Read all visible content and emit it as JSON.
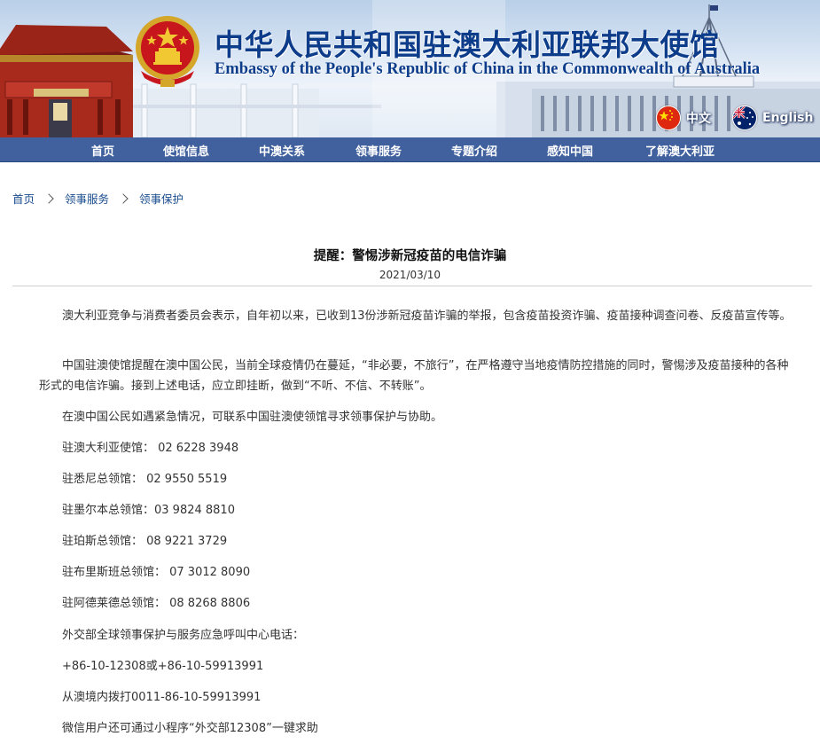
{
  "header": {
    "title_cn": "中华人民共和国驻澳大利亚联邦大使馆",
    "title_en": "Embassy of the People's Republic of China in the Commonwealth of Australia",
    "lang_cn": "中文",
    "lang_en": "English"
  },
  "nav": {
    "items": [
      "首页",
      "使馆信息",
      "中澳关系",
      "领事服务",
      "专题介绍",
      "感知中国",
      "了解澳大利亚"
    ]
  },
  "breadcrumb": [
    "首页",
    "领事服务",
    "领事保护"
  ],
  "article": {
    "title": "提醒：警惕涉新冠疫苗的电信诈骗",
    "date": "2021/03/10",
    "paragraphs": [
      "澳大利亚竞争与消费者委员会表示，自年初以来，已收到13份涉新冠疫苗诈骗的举报，包含疫苗投资诈骗、疫苗接种调查问卷、反疫苗宣传等。",
      "中国驻澳使馆提醒在澳中国公民，当前全球疫情仍在蔓延，“非必要，不旅行”，在严格遵守当地疫情防控措施的同时，警惕涉及疫苗接种的各种形式的电信诈骗。接到上述电话，应立即挂断，做到“不听、不信、不转账”。",
      "在澳中国公民如遇紧急情况，可联系中国驻澳使领馆寻求领事保护与协助。",
      "驻澳大利亚使馆： 02 6228 3948",
      "驻悉尼总领馆： 02 9550 5519",
      "驻墨尔本总领馆：03 9824 8810",
      "驻珀斯总领馆： 08 9221 3729",
      "驻布里斯班总领馆： 07 3012 8090",
      "驻阿德莱德总领馆： 08 8268 8806",
      "外交部全球领事保护与服务应急呼叫中心电话：",
      "+86-10-12308或+86-10-59913991",
      "从澳境内拨打0011-86-10-59913991",
      "微信用户还可通过小程序“外交部12308”一键求助"
    ]
  },
  "colors": {
    "nav_bg": "#40609e",
    "title_blue": "#0c3c8a",
    "link_blue": "#1a4d8f"
  },
  "icons": [
    "national-emblem-icon",
    "china-flag-icon",
    "australia-flag-icon",
    "chevron-right-icon"
  ]
}
